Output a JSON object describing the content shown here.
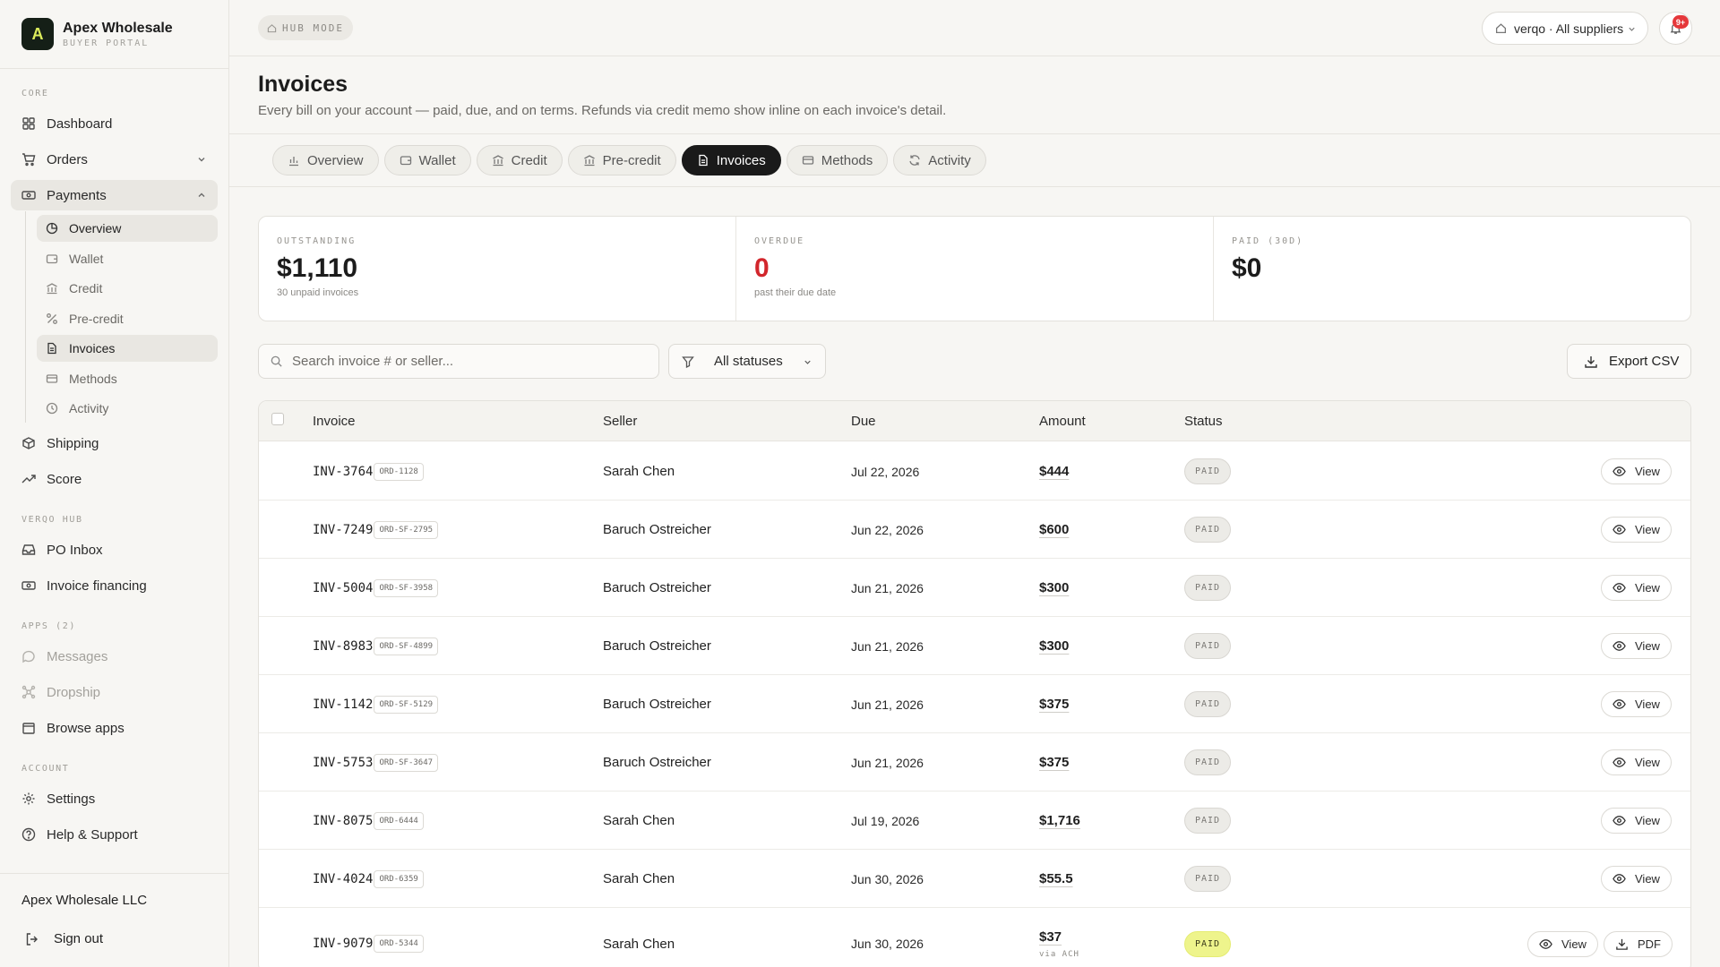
{
  "brand": {
    "logo_letter": "A",
    "name": "Apex Wholesale",
    "subtitle": "BUYER PORTAL"
  },
  "sidebar": {
    "sections": {
      "core": "CORE",
      "hub": "VERQO HUB",
      "apps": "APPS (2)",
      "account": "ACCOUNT"
    },
    "core_items": [
      "Dashboard",
      "Orders",
      "Payments"
    ],
    "payments_sub": [
      "Overview",
      "Wallet",
      "Credit",
      "Pre-credit",
      "Invoices",
      "Methods",
      "Activity"
    ],
    "core_more": [
      "Shipping",
      "Score"
    ],
    "hub_items": [
      "PO Inbox",
      "Invoice financing"
    ],
    "app_items": [
      "Messages",
      "Dropship",
      "Browse apps"
    ],
    "account_items": [
      "Settings",
      "Help & Support"
    ],
    "company": "Apex Wholesale LLC",
    "signout": "Sign out"
  },
  "topbar": {
    "mode": "HUB MODE",
    "supplier": "verqo · All suppliers",
    "notifications": "9+"
  },
  "header": {
    "title": "Invoices",
    "subtitle": "Every bill on your account — paid, due, and on terms. Refunds via credit memo show inline on each invoice's detail."
  },
  "tabs": [
    "Overview",
    "Wallet",
    "Credit",
    "Pre-credit",
    "Invoices",
    "Methods",
    "Activity"
  ],
  "summary": {
    "outstanding": {
      "label": "OUTSTANDING",
      "value": "$1,110",
      "note": "30 unpaid invoices"
    },
    "overdue": {
      "label": "OVERDUE",
      "value": "0",
      "note": "past their due date"
    },
    "paid": {
      "label": "PAID (30D)",
      "value": "$0"
    }
  },
  "controls": {
    "search_placeholder": "Search invoice # or seller...",
    "status_filter": "All statuses",
    "export": "Export CSV"
  },
  "table": {
    "columns": {
      "invoice": "Invoice",
      "seller": "Seller",
      "due": "Due",
      "amount": "Amount",
      "status": "Status"
    },
    "view_label": "View",
    "pdf_label": "PDF",
    "rows": [
      {
        "invoice": "INV-3764",
        "order": "ORD-1128",
        "seller": "Sarah Chen",
        "due": "Jul 22, 2026",
        "amount": "$444",
        "status": "PAID"
      },
      {
        "invoice": "INV-7249",
        "order": "ORD-SF-2795",
        "seller": "Baruch Ostreicher",
        "due": "Jun 22, 2026",
        "amount": "$600",
        "status": "PAID"
      },
      {
        "invoice": "INV-5004",
        "order": "ORD-SF-3958",
        "seller": "Baruch Ostreicher",
        "due": "Jun 21, 2026",
        "amount": "$300",
        "status": "PAID"
      },
      {
        "invoice": "INV-8983",
        "order": "ORD-SF-4899",
        "seller": "Baruch Ostreicher",
        "due": "Jun 21, 2026",
        "amount": "$300",
        "status": "PAID"
      },
      {
        "invoice": "INV-1142",
        "order": "ORD-SF-5129",
        "seller": "Baruch Ostreicher",
        "due": "Jun 21, 2026",
        "amount": "$375",
        "status": "PAID"
      },
      {
        "invoice": "INV-5753",
        "order": "ORD-SF-3647",
        "seller": "Baruch Ostreicher",
        "due": "Jun 21, 2026",
        "amount": "$375",
        "status": "PAID"
      },
      {
        "invoice": "INV-8075",
        "order": "ORD-6444",
        "seller": "Sarah Chen",
        "due": "Jul 19, 2026",
        "amount": "$1,716",
        "status": "PAID"
      },
      {
        "invoice": "INV-4024",
        "order": "ORD-6359",
        "seller": "Sarah Chen",
        "due": "Jun 30, 2026",
        "amount": "$55.5",
        "status": "PAID"
      },
      {
        "invoice": "INV-9079",
        "order": "ORD-5344",
        "seller": "Sarah Chen",
        "due": "Jun 30, 2026",
        "amount": "$37",
        "via": "via ACH",
        "status": "PAID"
      }
    ]
  }
}
